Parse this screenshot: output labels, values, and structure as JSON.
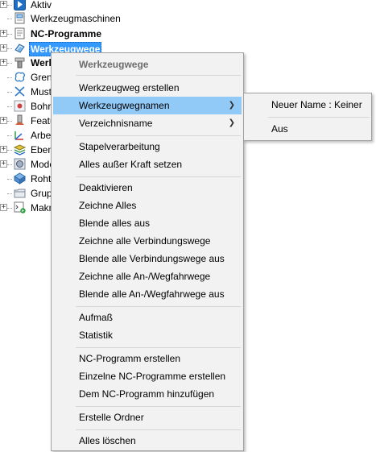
{
  "tree": {
    "items": [
      {
        "label": "Aktiv",
        "icon": "active-arrow-icon",
        "bold": false,
        "selected": false
      },
      {
        "label": "Werkzeugmaschinen",
        "icon": "machine-tool-icon",
        "bold": false,
        "selected": false
      },
      {
        "label": "NC-Programme",
        "icon": "nc-program-icon",
        "bold": true,
        "selected": false
      },
      {
        "label": "Werkzeugwege",
        "icon": "toolpath-icon",
        "bold": true,
        "selected": true
      },
      {
        "label": "Werkz",
        "icon": "tool-icon",
        "bold": true,
        "selected": false
      },
      {
        "label": "Grenz",
        "icon": "boundary-icon",
        "bold": false,
        "selected": false
      },
      {
        "label": "Must",
        "icon": "pattern-icon",
        "bold": false,
        "selected": false
      },
      {
        "label": "Bohr",
        "icon": "drill-icon",
        "bold": false,
        "selected": false
      },
      {
        "label": "Featu",
        "icon": "feature-icon",
        "bold": false,
        "selected": false
      },
      {
        "label": "Arbei",
        "icon": "workplane-icon",
        "bold": false,
        "selected": false
      },
      {
        "label": "Eben",
        "icon": "layers-icon",
        "bold": false,
        "selected": false
      },
      {
        "label": "Mode",
        "icon": "model-icon",
        "bold": false,
        "selected": false
      },
      {
        "label": "Rohte",
        "icon": "stock-icon",
        "bold": false,
        "selected": false
      },
      {
        "label": "Grup",
        "icon": "group-folder-icon",
        "bold": false,
        "selected": false
      },
      {
        "label": "Makr",
        "icon": "macro-icon",
        "bold": false,
        "selected": false
      }
    ]
  },
  "menu": {
    "title": "Werkzeugwege",
    "groups": [
      [
        {
          "label": "Werkzeugweg erstellen"
        },
        {
          "label": "Werkzeugwegnamen",
          "submenu": true,
          "highlighted": true
        },
        {
          "label": "Verzeichnisname",
          "submenu": true
        }
      ],
      [
        {
          "label": "Stapelverarbeitung"
        },
        {
          "label": "Alles außer Kraft setzen"
        }
      ],
      [
        {
          "label": "Deaktivieren"
        },
        {
          "label": "Zeichne Alles"
        },
        {
          "label": "Blende alles aus"
        },
        {
          "label": "Zeichne alle Verbindungswege"
        },
        {
          "label": "Blende alle Verbindungswege aus"
        },
        {
          "label": "Zeichne alle An-/Wegfahrwege"
        },
        {
          "label": "Blende alle An-/Wegfahrwege aus"
        }
      ],
      [
        {
          "label": "Aufmaß"
        },
        {
          "label": "Statistik"
        }
      ],
      [
        {
          "label": "NC-Programm erstellen"
        },
        {
          "label": "Einzelne NC-Programme erstellen"
        },
        {
          "label": "Dem NC-Programm hinzufügen"
        }
      ],
      [
        {
          "label": "Erstelle Ordner"
        }
      ],
      [
        {
          "label": "Alles löschen"
        }
      ]
    ]
  },
  "submenu": {
    "items": [
      {
        "label": "Neuer Name : Keiner"
      },
      {
        "label": "Aus"
      }
    ]
  },
  "colors": {
    "selection": "#3399ff",
    "menu_highlight": "#91c9f7",
    "menu_background": "#f2f2f2"
  }
}
